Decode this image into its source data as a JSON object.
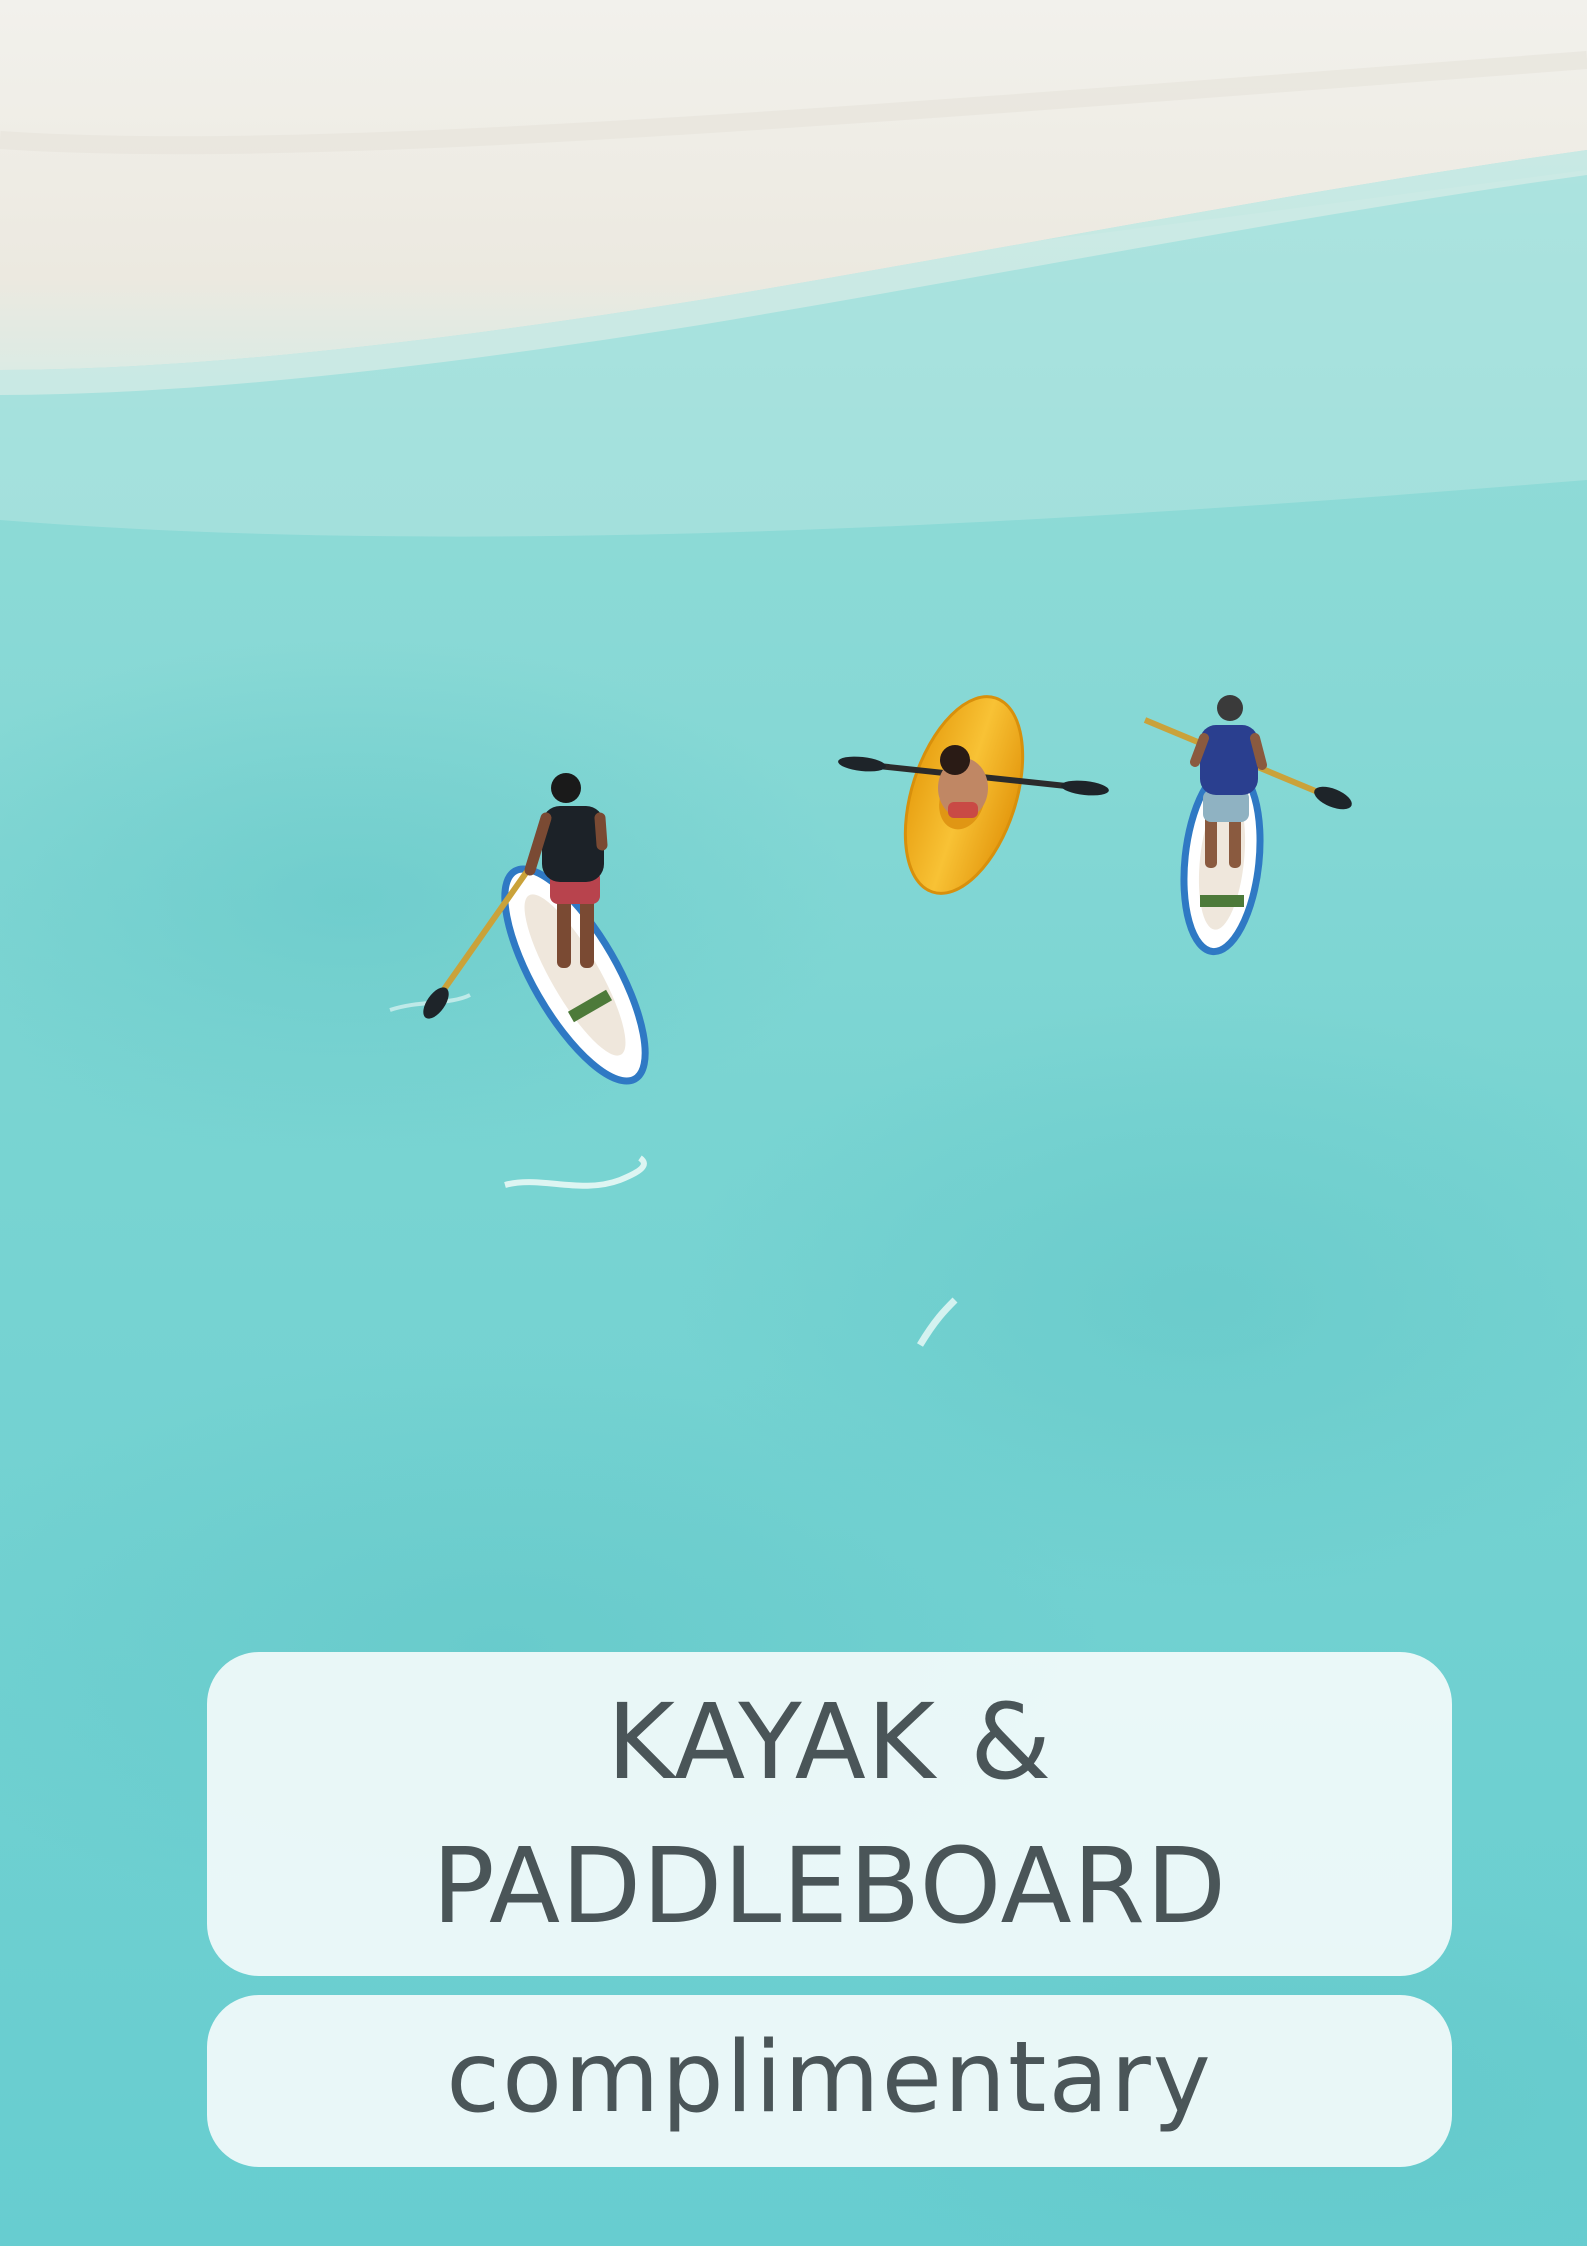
{
  "title": {
    "line1": "KAYAK &",
    "line2": "PADDLEBOARD"
  },
  "subtitle": "complimentary",
  "colors": {
    "text": "#4a5558",
    "panel": "#f1fafa",
    "water": "#6ecfce",
    "sand": "#efeee9",
    "kayak": "#f4b320",
    "board_edge": "#2f79c4"
  }
}
